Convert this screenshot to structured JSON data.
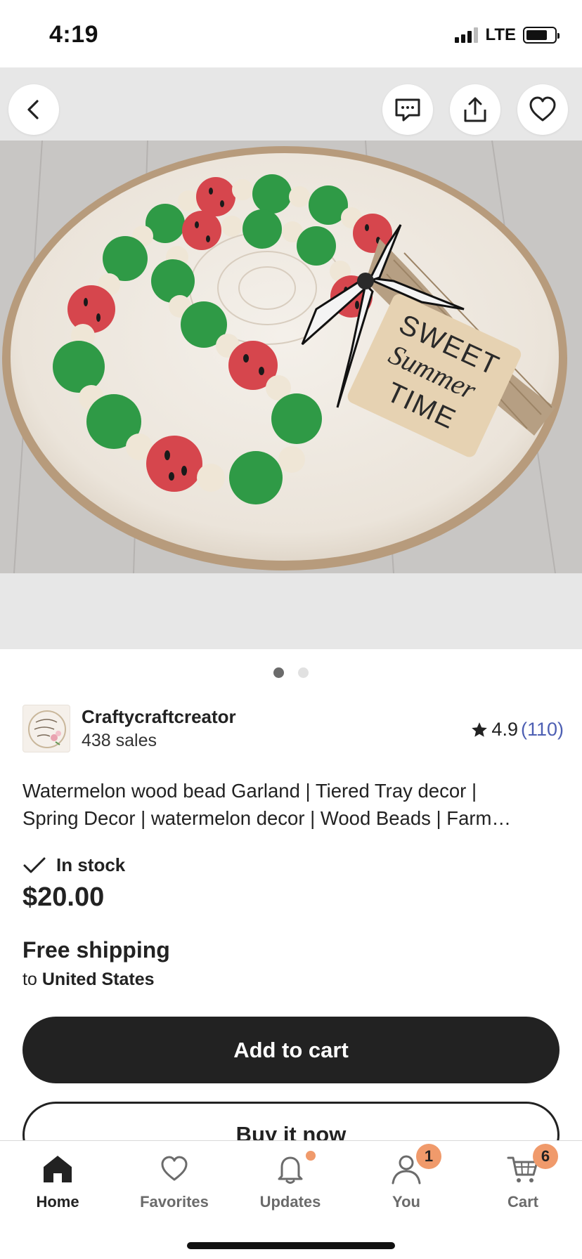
{
  "status_bar": {
    "time": "4:19",
    "network": "LTE",
    "battery_level": 0.75
  },
  "hero": {
    "back_icon": "chevron-left-icon",
    "message_icon": "message-icon",
    "share_icon": "share-icon",
    "favorite_icon": "heart-icon",
    "tag_lines": [
      "SWEET",
      "Summer",
      "TIME"
    ],
    "image_count": 2,
    "active_image": 1
  },
  "seller": {
    "name": "Craftycraftcreator",
    "sales": "438 sales",
    "rating": "4.9",
    "review_count": "(110)"
  },
  "listing": {
    "title_line1": "Watermelon wood bead Garland | Tiered Tray decor |",
    "title_line2": "Spring Decor | watermelon decor | Wood Beads | Farm…",
    "stock_status": "In stock",
    "price": "$20.00"
  },
  "shipping": {
    "headline": "Free shipping",
    "to_prefix": "to",
    "destination": "United States"
  },
  "actions": {
    "add_to_cart": "Add to cart",
    "buy_now": "Buy it now"
  },
  "tabbar": {
    "items": [
      {
        "label": "Home",
        "icon": "home-icon",
        "active": true
      },
      {
        "label": "Favorites",
        "icon": "heart-icon"
      },
      {
        "label": "Updates",
        "icon": "bell-icon"
      },
      {
        "label": "You",
        "icon": "person-icon",
        "badge": "1"
      },
      {
        "label": "Cart",
        "icon": "cart-icon",
        "badge": "6"
      }
    ]
  },
  "colors": {
    "primary": "#222222",
    "accent_badge": "#f09a6b",
    "rating_link": "#4d5fb3",
    "watermelon_red": "#d6464d",
    "bead_green": "#2f9a46"
  }
}
